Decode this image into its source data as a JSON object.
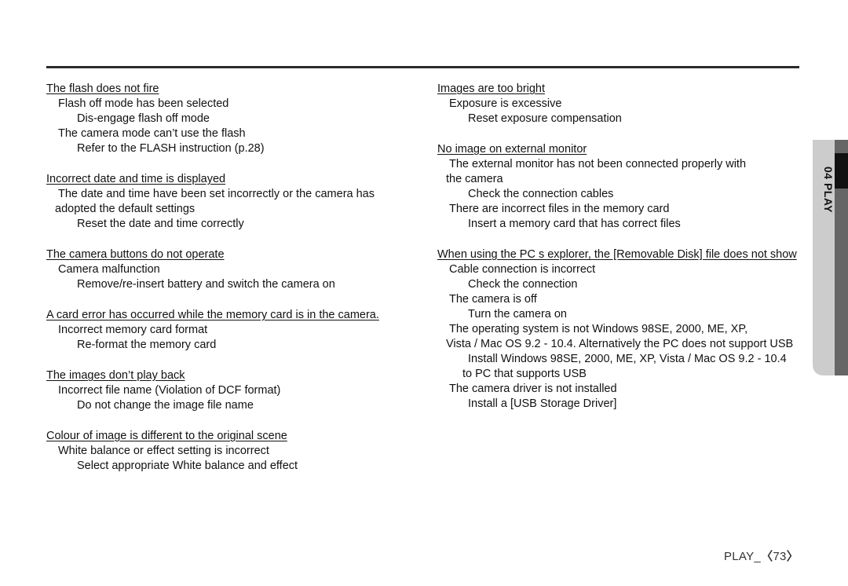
{
  "page": {
    "footer_label": "PLAY_",
    "footer_bracket_open": "〈",
    "footer_page_number": "73",
    "footer_bracket_close": "〉",
    "side_tab_label": "04 PLAY",
    "rule_color": "#2b2b2b",
    "tab_plate_color": "#cccccc",
    "tab_rail_color": "#666666",
    "tab_marker_color": "#111111"
  },
  "left_column": {
    "sections": [
      {
        "heading": "The flash does not fire",
        "lines": [
          {
            "level": "cause",
            "text": "Flash off mode has been selected"
          },
          {
            "level": "remedy",
            "text": "Dis-engage flash off mode"
          },
          {
            "level": "cause",
            "text": "The camera mode can’t use the flash"
          },
          {
            "level": "remedy",
            "text": "Refer to the FLASH instruction (p.28)"
          }
        ]
      },
      {
        "heading": "Incorrect date and time is displayed",
        "lines": [
          {
            "level": "cause",
            "text": "The date and time have been set incorrectly or the camera has"
          },
          {
            "level": "cont",
            "text": "adopted the default settings"
          },
          {
            "level": "remedy",
            "text": "Reset the date and time correctly"
          }
        ]
      },
      {
        "heading": "The camera buttons do not operate",
        "lines": [
          {
            "level": "cause",
            "text": "Camera malfunction"
          },
          {
            "level": "remedy",
            "text": "Remove/re-insert battery and switch the camera on"
          }
        ]
      },
      {
        "heading": "A card error has occurred while the memory card is in the camera.",
        "lines": [
          {
            "level": "cause",
            "text": "Incorrect memory card format"
          },
          {
            "level": "remedy",
            "text": "Re-format the memory card"
          }
        ]
      },
      {
        "heading": "The images don’t play back",
        "lines": [
          {
            "level": "cause",
            "text": "Incorrect file name (Violation of DCF format)"
          },
          {
            "level": "remedy",
            "text": "Do not change the image file name"
          }
        ]
      },
      {
        "heading": "Colour of image is different to the original scene",
        "lines": [
          {
            "level": "cause",
            "text": "White balance or effect setting is incorrect"
          },
          {
            "level": "remedy",
            "text": "Select appropriate White balance and effect"
          }
        ]
      }
    ]
  },
  "right_column": {
    "sections": [
      {
        "heading": "Images are too bright",
        "lines": [
          {
            "level": "cause",
            "text": "Exposure is excessive"
          },
          {
            "level": "remedy",
            "text": "Reset exposure compensation"
          }
        ]
      },
      {
        "heading": "No image on external monitor",
        "lines": [
          {
            "level": "cause",
            "text": "The external monitor has not been connected properly with"
          },
          {
            "level": "cont",
            "text": "the camera"
          },
          {
            "level": "remedy",
            "text": "Check the connection cables"
          },
          {
            "level": "cause",
            "text": "There are incorrect files in the memory card"
          },
          {
            "level": "remedy",
            "text": "Insert a memory card that has correct files"
          }
        ]
      },
      {
        "heading": "When using the PC s explorer, the [Removable Disk] file does not show",
        "lines": [
          {
            "level": "cause",
            "text": "Cable connection is incorrect"
          },
          {
            "level": "remedy",
            "text": "Check the connection"
          },
          {
            "level": "cause",
            "text": "The camera is off"
          },
          {
            "level": "remedy",
            "text": "Turn the camera on"
          },
          {
            "level": "cause",
            "text": "The operating system is not Windows 98SE, 2000, ME, XP,"
          },
          {
            "level": "cont",
            "text": "Vista / Mac OS 9.2 - 10.4. Alternatively the PC does not support USB"
          },
          {
            "level": "remedy",
            "text": "Install Windows 98SE, 2000, ME, XP, Vista / Mac OS 9.2 - 10.4"
          },
          {
            "level": "cont2",
            "text": "to PC that supports USB"
          },
          {
            "level": "cause",
            "text": "The camera driver is not installed"
          },
          {
            "level": "remedy",
            "text": "Install a [USB Storage Driver]"
          }
        ]
      }
    ]
  }
}
